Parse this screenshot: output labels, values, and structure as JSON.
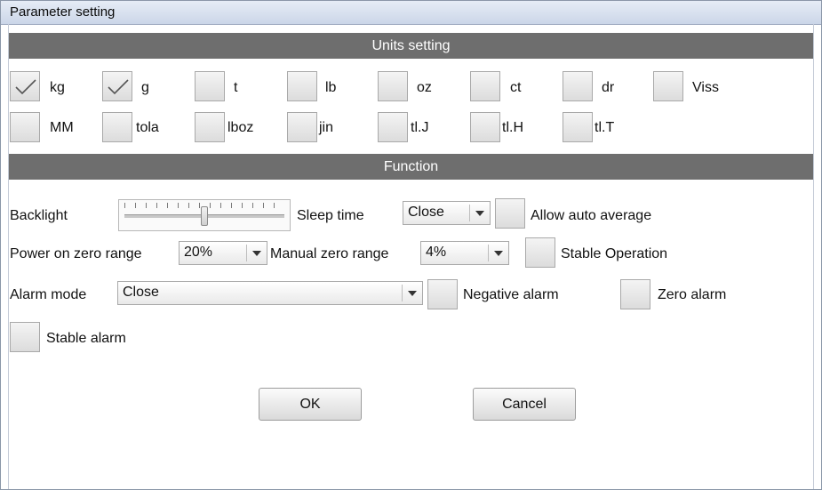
{
  "window": {
    "title": "Parameter setting"
  },
  "sections": {
    "units": "Units setting",
    "function": "Function"
  },
  "units": [
    {
      "label": "kg",
      "checked": true
    },
    {
      "label": "g",
      "checked": true
    },
    {
      "label": "t",
      "checked": false
    },
    {
      "label": "lb",
      "checked": false
    },
    {
      "label": "oz",
      "checked": false
    },
    {
      "label": "ct",
      "checked": false
    },
    {
      "label": "dr",
      "checked": false
    },
    {
      "label": "Viss",
      "checked": false
    },
    {
      "label": "MM",
      "checked": false
    },
    {
      "label": "tola",
      "checked": false
    },
    {
      "label": "lboz",
      "checked": false
    },
    {
      "label": "jin",
      "checked": false
    },
    {
      "label": "tl.J",
      "checked": false
    },
    {
      "label": "tl.H",
      "checked": false
    },
    {
      "label": "tl.T",
      "checked": false
    }
  ],
  "function": {
    "backlight_label": "Backlight",
    "backlight_level": 0.5,
    "sleep_time_label": "Sleep time",
    "sleep_time_value": "Close",
    "allow_auto_average_label": "Allow auto average",
    "allow_auto_average_checked": false,
    "power_on_zero_label": "Power on zero range",
    "power_on_zero_value": "20%",
    "manual_zero_label": "Manual zero range",
    "manual_zero_value": "4%",
    "stable_operation_label": "Stable Operation",
    "stable_operation_checked": false,
    "alarm_mode_label": "Alarm mode",
    "alarm_mode_value": "Close",
    "negative_alarm_label": "Negative alarm",
    "negative_alarm_checked": false,
    "zero_alarm_label": "Zero alarm",
    "zero_alarm_checked": false,
    "stable_alarm_label": "Stable alarm",
    "stable_alarm_checked": false
  },
  "buttons": {
    "ok": "OK",
    "cancel": "Cancel"
  }
}
